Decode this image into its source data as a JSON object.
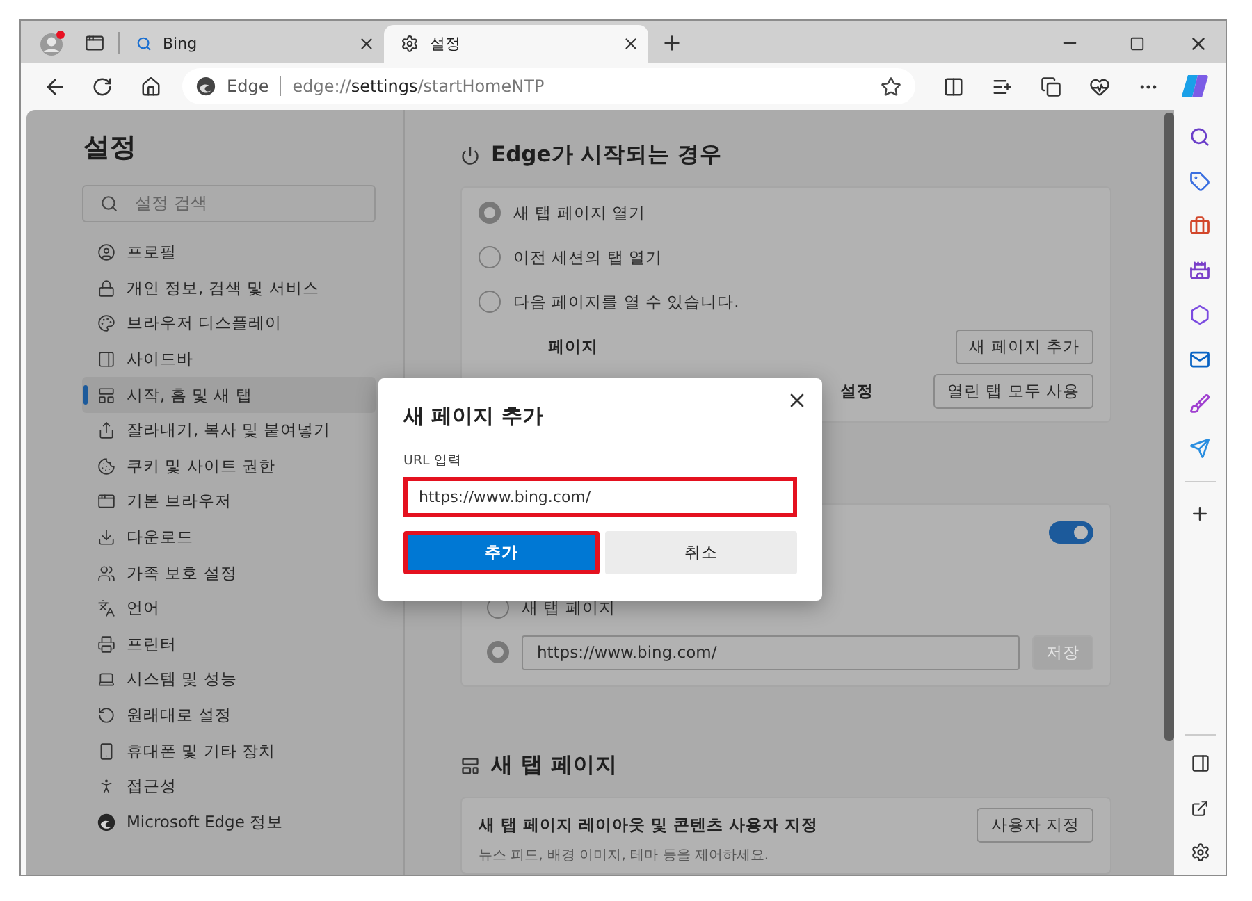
{
  "tabs": [
    {
      "title": "Bing",
      "kind": "search",
      "selected": false
    },
    {
      "title": "설정",
      "kind": "settings",
      "selected": true
    }
  ],
  "address_bar": {
    "site_label": "Edge",
    "url_scheme": "edge://",
    "url_host": "settings",
    "url_path": "/startHomeNTP"
  },
  "settings_nav": {
    "title": "설정",
    "search": {
      "placeholder": "설정 검색"
    },
    "items": [
      {
        "label": "프로필",
        "kind": "profile",
        "selected": false
      },
      {
        "label": "개인 정보, 검색 및 서비스",
        "kind": "privacy",
        "selected": false
      },
      {
        "label": "브라우저 디스플레이",
        "kind": "appearance",
        "selected": false
      },
      {
        "label": "사이드바",
        "kind": "sidebar",
        "selected": false
      },
      {
        "label": "시작, 홈 및 새 탭",
        "kind": "start",
        "selected": true
      },
      {
        "label": "잘라내기, 복사 및 붙여넣기",
        "kind": "share",
        "selected": false
      },
      {
        "label": "쿠키 및 사이트 권한",
        "kind": "cookies",
        "selected": false
      },
      {
        "label": "기본 브라우저",
        "kind": "browser",
        "selected": false
      },
      {
        "label": "다운로드",
        "kind": "download",
        "selected": false
      },
      {
        "label": "가족 보호 설정",
        "kind": "family",
        "selected": false
      },
      {
        "label": "언어",
        "kind": "language",
        "selected": false
      },
      {
        "label": "프린터",
        "kind": "printer",
        "selected": false
      },
      {
        "label": "시스템 및 성능",
        "kind": "system",
        "selected": false
      },
      {
        "label": "원래대로 설정",
        "kind": "reset",
        "selected": false
      },
      {
        "label": "휴대폰 및 기타 장치",
        "kind": "phone",
        "selected": false
      },
      {
        "label": "접근성",
        "kind": "accessibility",
        "selected": false
      },
      {
        "label": "Microsoft Edge 정보",
        "kind": "edge",
        "selected": false
      }
    ]
  },
  "startup": {
    "title": "Edge가 시작되는 경우",
    "options": [
      {
        "label": "새 탭 페이지 열기",
        "selected": true
      },
      {
        "label": "이전 세션의 탭 열기",
        "selected": false
      },
      {
        "label": "다음 페이지를 열 수 있습니다.",
        "selected": false
      }
    ],
    "pages_label": "페이지",
    "add_button": "새 페이지 추가",
    "set_label": "설정",
    "use_open_tabs_button": "열린 탭 모두 사용"
  },
  "home_button": {
    "toggle_on": true,
    "options": [
      {
        "kind": "label",
        "label": "새 탭 페이지",
        "selected": false
      },
      {
        "kind": "url",
        "value": "https://www.bing.com/",
        "selected": true
      }
    ],
    "save_button": {
      "label": "저장",
      "disabled": true
    }
  },
  "new_tab": {
    "title": "새 탭 페이지",
    "card_title": "새 탭 페이지 레이아웃 및 콘텐츠 사용자 지정",
    "card_subtitle": "뉴스 피드, 배경 이미지, 테마 등을 제어하세요.",
    "button": "사용자 지정"
  },
  "dialog": {
    "title": "새 페이지 추가",
    "field_label": "URL 입력",
    "field": {
      "value": "https://www.bing.com/",
      "highlighted": true
    },
    "confirm": {
      "label": "추가",
      "highlighted": true
    },
    "cancel": "취소"
  }
}
